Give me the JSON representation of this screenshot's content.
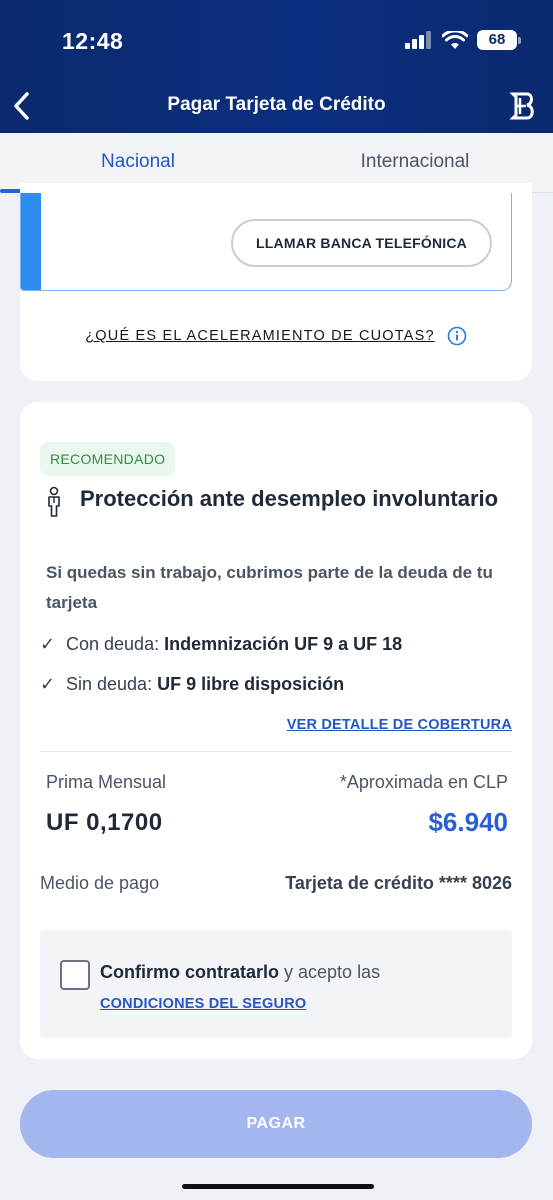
{
  "status_bar": {
    "time": "12:48",
    "battery": "68"
  },
  "header": {
    "title": "Pagar Tarjeta de Crédito"
  },
  "tabs": [
    {
      "label": "Nacional",
      "active": true
    },
    {
      "label": "Internacional",
      "active": false
    }
  ],
  "prev_card": {
    "call_button": "LLAMAR BANCA TELEFÓNICA",
    "acceleration_link": "¿QUÉ ES EL ACELERAMIENTO DE CUOTAS?"
  },
  "insurance": {
    "badge": "RECOMENDADO",
    "title": "Protección ante desempleo involuntario",
    "subtitle": "Si quedas sin trabajo, cubrimos parte de la deuda de tu tarjeta",
    "bullets": [
      {
        "label": "Con deuda:",
        "value": "Indemnización UF 9 a UF 18"
      },
      {
        "label": "Sin deuda:",
        "value": "UF 9 libre disposición"
      }
    ],
    "detail_link": "VER DETALLE DE COBERTURA",
    "premium_label": "Prima Mensual",
    "premium_value": "UF 0,1700",
    "approx_label": "*Aproximada en CLP",
    "approx_value": "$6.940",
    "payment_method_label": "Medio de pago",
    "payment_method_value": "Tarjeta de crédito **** 8026",
    "confirm_bold": "Confirmo contratarlo",
    "confirm_rest": " y acepto las",
    "conditions_link": "CONDICIONES DEL SEGURO"
  },
  "pay_button": "PAGAR",
  "colors": {
    "primary": "#2456c7",
    "header_bg": "#0b2a6d",
    "badge_green": "#2f8d44",
    "pay_disabled": "#a4b6ee"
  }
}
